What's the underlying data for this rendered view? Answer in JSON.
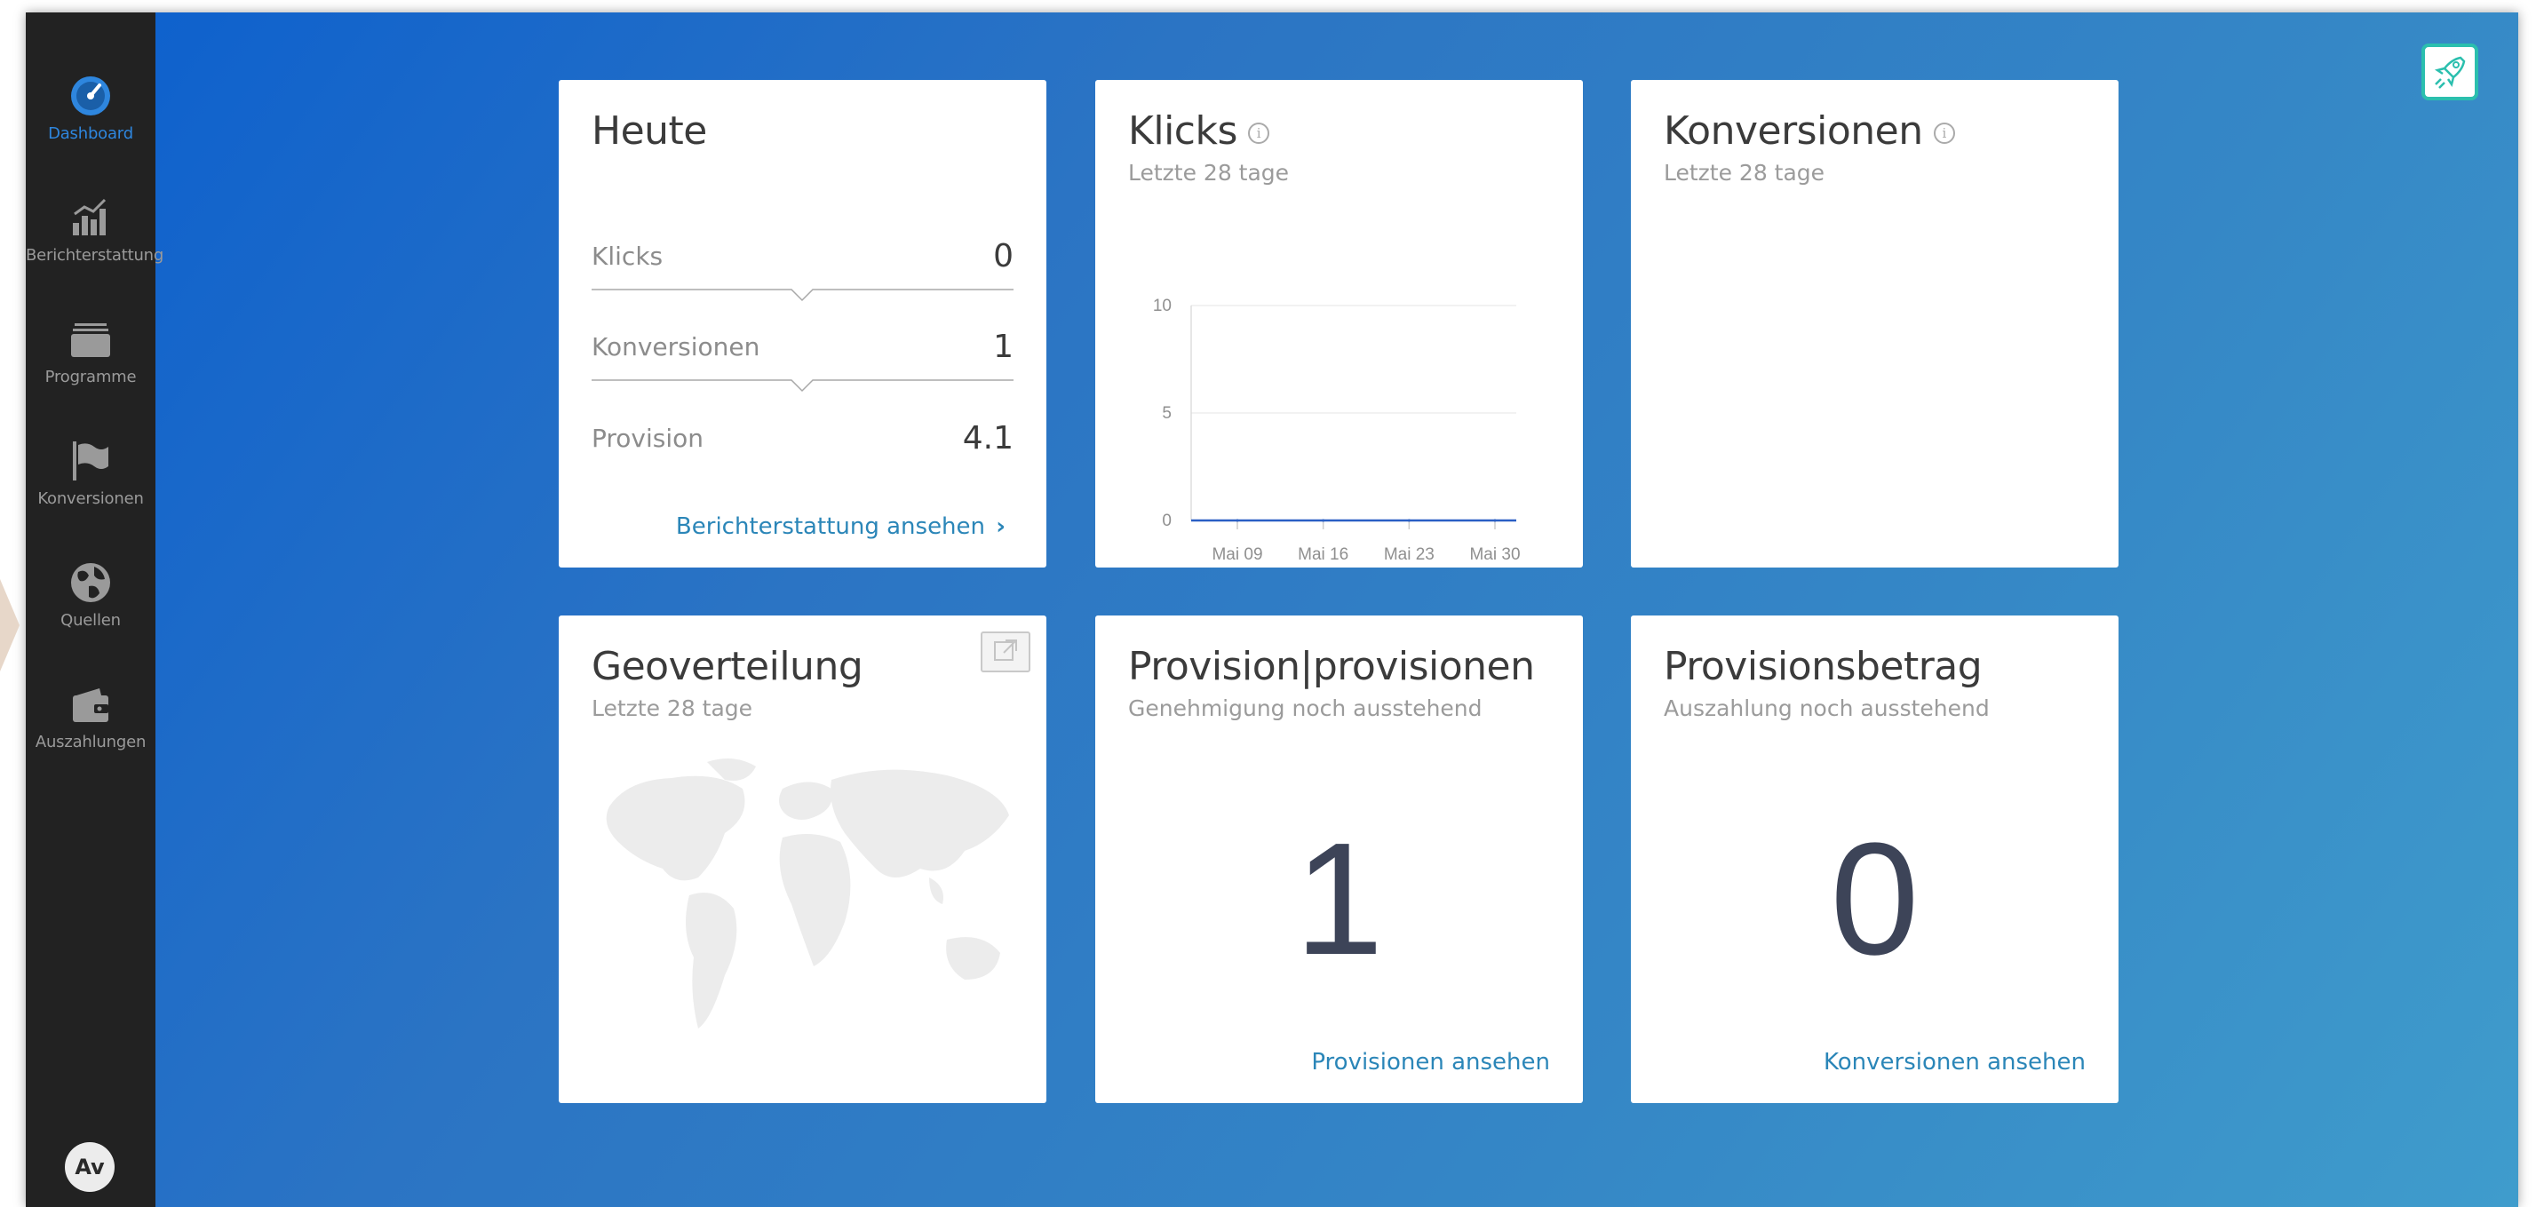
{
  "sidebar": {
    "items": [
      {
        "label": "Dashboard",
        "icon": "dashboard-gauge-icon",
        "active": true
      },
      {
        "label": "Berichterstattung",
        "icon": "bar-chart-icon",
        "active": false
      },
      {
        "label": "Programme",
        "icon": "folder-stack-icon",
        "active": false
      },
      {
        "label": "Konversionen",
        "icon": "flag-icon",
        "active": false
      },
      {
        "label": "Quellen",
        "icon": "globe-icon",
        "active": false
      },
      {
        "label": "Auszahlungen",
        "icon": "wallet-icon",
        "active": false
      }
    ],
    "avatar": "Av"
  },
  "colors": {
    "accent": "#2e86de",
    "link": "#2b86b8",
    "rocket_border": "#2bbfae",
    "chart_line": "#2a5fc4"
  },
  "today": {
    "title": "Heute",
    "rows": [
      {
        "label": "Klicks",
        "value": "0"
      },
      {
        "label": "Konversionen",
        "value": "1"
      },
      {
        "label": "Provision",
        "value": "4.1"
      }
    ],
    "link": "Berichterstattung ansehen"
  },
  "clicks": {
    "title": "Klicks",
    "subtitle": "Letzte 28 tage"
  },
  "conversions": {
    "title": "Konversionen",
    "subtitle": "Letzte 28 tage"
  },
  "geo": {
    "title": "Geoverteilung",
    "subtitle": "Letzte 28 tage"
  },
  "provision": {
    "title": "Provision|provisionen",
    "subtitle": "Genehmigung noch ausstehend",
    "value": "1",
    "link": "Provisionen ansehen"
  },
  "amount": {
    "title": "Provisionsbetrag",
    "subtitle": "Auszahlung noch ausstehend",
    "value": "0",
    "link": "Konversionen ansehen"
  },
  "chart_data": {
    "type": "line",
    "categories": [
      "Mai 09",
      "Mai 16",
      "Mai 23",
      "Mai 30"
    ],
    "series": [
      {
        "values": [
          0,
          0,
          0,
          0
        ]
      }
    ],
    "yticks": [
      "0",
      "5",
      "10"
    ],
    "ylim": [
      0,
      10
    ],
    "grid": true
  }
}
